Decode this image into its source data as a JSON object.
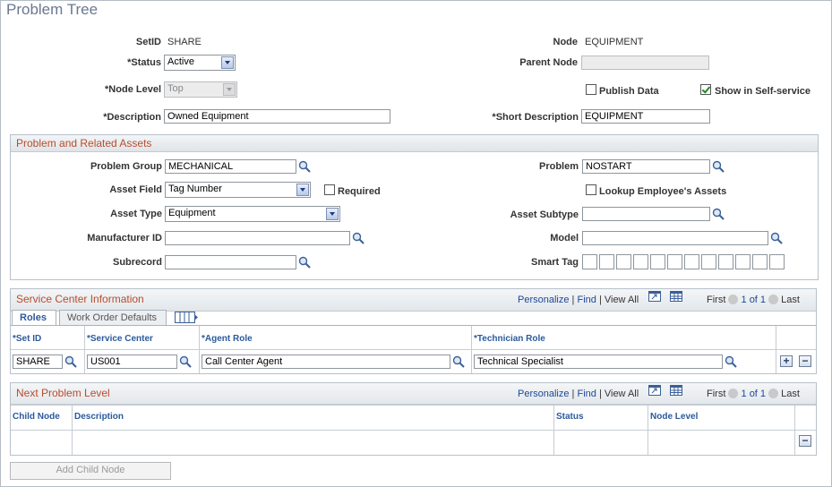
{
  "page": {
    "title": "Problem Tree"
  },
  "header": {
    "setid_label": "SetID",
    "setid_value": "SHARE",
    "node_label": "Node",
    "node_value": "EQUIPMENT",
    "status_label": "*Status",
    "status_value": "Active",
    "parent_node_label": "Parent Node",
    "parent_node_value": "",
    "node_level_label": "*Node Level",
    "node_level_value": "Top",
    "publish_data_label": "Publish Data",
    "publish_data_checked": false,
    "self_service_label": "Show in Self-service",
    "self_service_checked": true,
    "description_label": "*Description",
    "description_value": "Owned Equipment",
    "short_description_label": "*Short Description",
    "short_description_value": "EQUIPMENT"
  },
  "problem_assets": {
    "title": "Problem and Related Assets",
    "problem_group_label": "Problem Group",
    "problem_group_value": "MECHANICAL",
    "problem_label": "Problem",
    "problem_value": "NOSTART",
    "asset_field_label": "Asset Field",
    "asset_field_value": "Tag Number",
    "required_label": "Required",
    "lookup_employee_label": "Lookup Employee's Assets",
    "asset_type_label": "Asset Type",
    "asset_type_value": "Equipment",
    "asset_subtype_label": "Asset Subtype",
    "asset_subtype_value": "",
    "manufacturer_label": "Manufacturer ID",
    "manufacturer_value": "",
    "model_label": "Model",
    "model_value": "",
    "subrecord_label": "Subrecord",
    "subrecord_value": "",
    "smart_tag_label": "Smart Tag"
  },
  "service_center": {
    "title": "Service Center Information",
    "personalize": "Personalize",
    "find": "Find",
    "sep": "|",
    "view_all": "View All",
    "first": "First",
    "range": "1 of 1",
    "last": "Last",
    "tabs": [
      {
        "label": "Roles"
      },
      {
        "label": "Work Order Defaults"
      }
    ],
    "columns": {
      "setid": "*Set ID",
      "service_center": "*Service Center",
      "agent_role": "*Agent Role",
      "technician_role": "*Technician Role"
    },
    "row": {
      "setid": "SHARE",
      "service_center": "US001",
      "agent_role": "Call Center Agent",
      "technician_role": "Technical Specialist"
    },
    "add_symbol": "+",
    "delete_symbol": "−"
  },
  "next_level": {
    "title": "Next Problem Level",
    "personalize": "Personalize",
    "find": "Find",
    "sep": "|",
    "view_all": "View All",
    "first": "First",
    "range": "1 of 1",
    "last": "Last",
    "columns": {
      "child_node": "Child Node",
      "description": "Description",
      "status": "Status",
      "node_level": "Node Level"
    },
    "delete_symbol": "−",
    "add_child_button": "Add Child Node"
  },
  "colors": {
    "title": "#6a7891",
    "section_title": "#b74c2c",
    "link": "#1d4799",
    "column_head": "#2b5a9c"
  }
}
